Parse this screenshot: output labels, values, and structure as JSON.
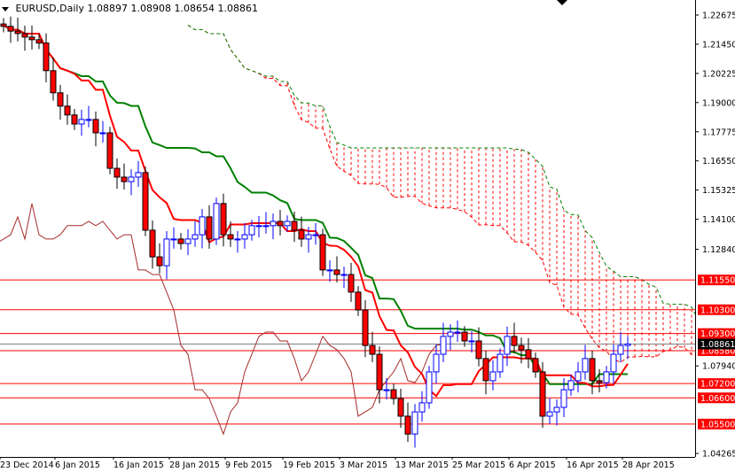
{
  "header": {
    "symbol": "EURUSD,Daily",
    "open": "1.08897",
    "high": "1.08908",
    "low": "1.08654",
    "close": "1.08861"
  },
  "colors": {
    "bull": "#0000ff",
    "bear": "#ff0000",
    "tenkan": "#ff0000",
    "kijun": "#008000",
    "chikou": "#a52a2a",
    "cloud": "#ff0000",
    "level": "#ff0000",
    "current": "#808080"
  },
  "chart_data": {
    "type": "candlestick",
    "title": "EURUSD,Daily",
    "indicator": "Ichimoku Kinko Hyo",
    "ylim": [
      1.04265,
      1.23
    ],
    "y_ticks": [
      "1.22675",
      "1.21450",
      "1.20225",
      "1.19000",
      "1.17775",
      "1.16550",
      "1.15325",
      "1.14100",
      "1.12840",
      "1.07940",
      "1.04265"
    ],
    "x_ticks": [
      "23 Dec 2014",
      "6 Jan 2015",
      "16 Jan 2015",
      "28 Jan 2015",
      "9 Feb 2015",
      "19 Feb 2015",
      "3 Mar 2015",
      "13 Mar 2015",
      "25 Mar 2015",
      "6 Apr 2015",
      "16 Apr 2015",
      "28 Apr 2015"
    ],
    "levels": [
      "1.11550",
      "1.10300",
      "1.09300",
      "1.08580",
      "1.07200",
      "1.06600",
      "1.05500"
    ],
    "current_price": "1.08861",
    "closes": [
      1.222,
      1.22,
      1.219,
      1.2175,
      1.2164,
      1.215,
      1.2034,
      1.1941,
      1.1885,
      1.1848,
      1.181,
      1.1829,
      1.1829,
      1.1773,
      1.1773,
      1.1624,
      1.1587,
      1.1568,
      1.1587,
      1.1606,
      1.1364,
      1.1252,
      1.1215,
      1.1327,
      1.1327,
      1.1308,
      1.1327,
      1.1345,
      1.142,
      1.1327,
      1.1476,
      1.1345,
      1.1327,
      1.1327,
      1.1345,
      1.1383,
      1.1383,
      1.1383,
      1.1401,
      1.1383,
      1.1401,
      1.1364,
      1.1327,
      1.1345,
      1.1345,
      1.1197,
      1.1197,
      1.1178,
      1.1178,
      1.1104,
      1.1029,
      1.088,
      1.0843,
      1.0694,
      1.0694,
      1.0657,
      1.0583,
      1.0508,
      1.0601,
      1.0639,
      1.0769,
      1.0843,
      1.0918,
      1.0936,
      1.0936,
      1.0899,
      1.0899,
      1.0825,
      1.0732,
      1.0769,
      1.0843,
      1.0918,
      1.088,
      1.0862,
      1.0825,
      1.0769,
      1.0583,
      1.0601,
      1.062,
      1.0694,
      1.0732,
      1.0769,
      1.0825,
      1.0732,
      1.0724,
      1.0769,
      1.0843,
      1.088,
      1.0886
    ]
  }
}
